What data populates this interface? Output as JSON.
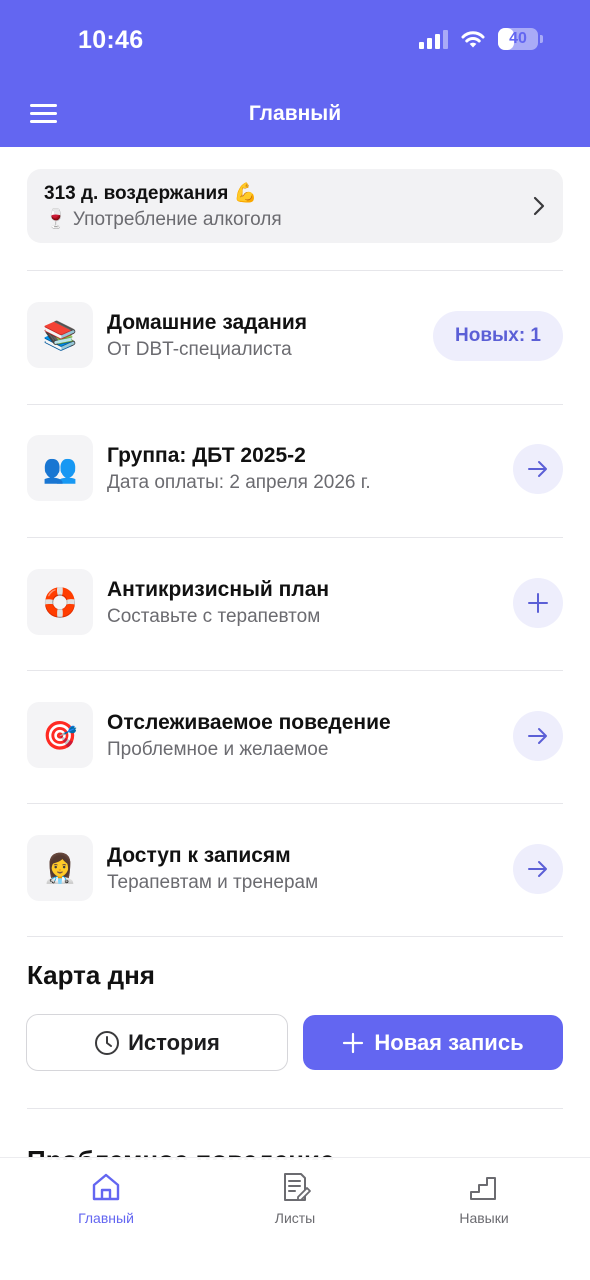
{
  "status_bar": {
    "time": "10:46",
    "battery": "40",
    "battery_level": 0.4
  },
  "header": {
    "title": "Главный"
  },
  "streak": {
    "title": "313 д. воздержания 💪",
    "subtitle": "🍷 Употребление алкоголя"
  },
  "items": [
    {
      "icon": "📚",
      "icon_name": "books-icon",
      "title": "Домашние задания",
      "subtitle": "От DBT-специалиста",
      "action": "badge",
      "badge": "Новых: 1"
    },
    {
      "icon": "👥",
      "icon_name": "group-icon",
      "title": "Группа: ДБТ 2025-2",
      "subtitle": "Дата оплаты: 2 апреля 2026 г.",
      "action": "arrow"
    },
    {
      "icon": "🛟",
      "icon_name": "lifebuoy-icon",
      "title": "Антикризисный план",
      "subtitle": "Составьте с терапевтом",
      "action": "plus"
    },
    {
      "icon": "🎯",
      "icon_name": "target-icon",
      "title": "Отслеживаемое поведение",
      "subtitle": "Проблемное и желаемое",
      "action": "arrow"
    },
    {
      "icon": "👩‍⚕️",
      "icon_name": "health-worker-icon",
      "title": "Доступ к записям",
      "subtitle": "Терапевтам и тренерам",
      "action": "arrow"
    }
  ],
  "day_card": {
    "title": "Карта дня",
    "history_label": "История",
    "new_entry_label": "Новая запись"
  },
  "next_section": {
    "title": "Проблемное поведение"
  },
  "tabbar": {
    "tabs": [
      {
        "label": "Главный",
        "icon": "home-icon",
        "active": true
      },
      {
        "label": "Листы",
        "icon": "sheets-icon",
        "active": false
      },
      {
        "label": "Навыки",
        "icon": "stairs-icon",
        "active": false
      }
    ]
  },
  "colors": {
    "accent": "#6366f1",
    "accent_soft": "#eeeefc"
  }
}
